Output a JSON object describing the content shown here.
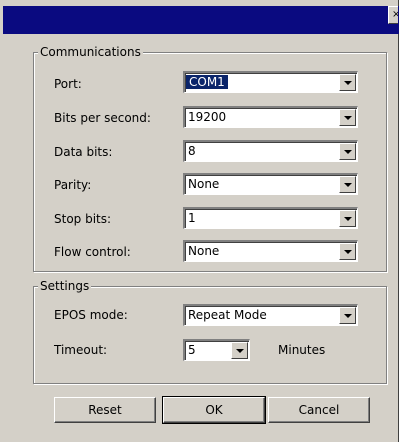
{
  "window": {
    "close_glyph": "×"
  },
  "communications": {
    "title": "Communications",
    "fields": [
      {
        "label": "Port:",
        "value": "COM1"
      },
      {
        "label": "Bits per second:",
        "value": "19200"
      },
      {
        "label": "Data bits:",
        "value": "8"
      },
      {
        "label": "Parity:",
        "value": "None"
      },
      {
        "label": "Stop bits:",
        "value": "1"
      },
      {
        "label": "Flow control:",
        "value": "None"
      }
    ]
  },
  "settings": {
    "title": "Settings",
    "epos_label": "EPOS mode:",
    "epos_value": "Repeat Mode",
    "timeout_label": "Timeout:",
    "timeout_value": "5",
    "timeout_unit": "Minutes"
  },
  "buttons": {
    "reset": "Reset",
    "ok": "OK",
    "cancel": "Cancel"
  }
}
